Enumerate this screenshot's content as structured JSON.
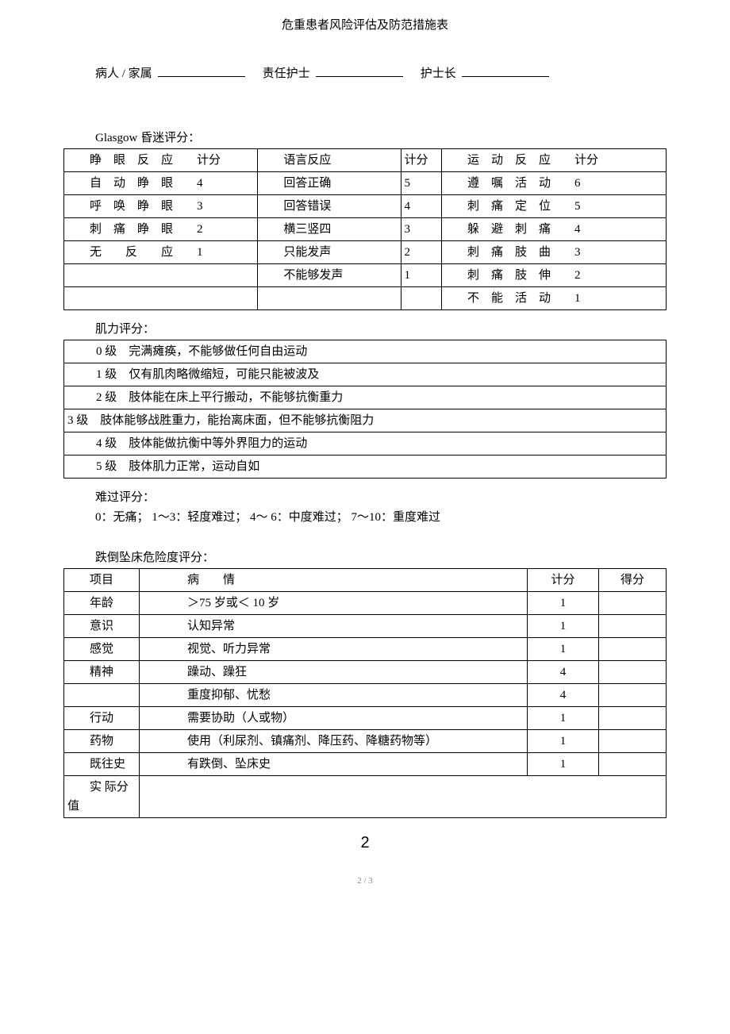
{
  "title": "危重患者风险评估及防范措施表",
  "signatures": {
    "patient_label": "病人 / 家属",
    "nurse_label": "责任护士",
    "headnurse_label": "护士长"
  },
  "glasgow": {
    "title": "Glasgow 昏迷评分：",
    "headers": {
      "eye": "睁　眼　反　应　　计分",
      "verbal": "语言反应",
      "vscore": "计分",
      "motor": "运　动　反　应　　计分"
    },
    "rows": [
      {
        "eye": "自　动　睁　眼　　4",
        "verbal": "回答正确",
        "vscore": "5",
        "motor": "遵　嘱　活　动　　6"
      },
      {
        "eye": "呼　唤　睁　眼　　3",
        "verbal": "回答错误",
        "vscore": "4",
        "motor": "刺　痛　定　位　　5"
      },
      {
        "eye": "刺　痛　睁　眼　　2",
        "verbal": "横三竖四",
        "vscore": "3",
        "motor": "躲　避　刺　痛　　4"
      },
      {
        "eye": "无　　反　　应　　1",
        "verbal": "只能发声",
        "vscore": "2",
        "motor": "刺　痛　肢　曲　　3"
      },
      {
        "eye": "",
        "verbal": "不能够发声",
        "vscore": "1",
        "motor": "刺　痛　肢　伸　　2"
      },
      {
        "eye": "",
        "verbal": "",
        "vscore": "",
        "motor": "不　能　活　动　　1"
      }
    ]
  },
  "muscle": {
    "title": "肌力评分：",
    "rows": [
      "0 级　完满瘫痪，不能够做任何自由运动",
      "1 级　仅有肌肉略微缩短，可能只能被波及",
      "2 级　肢体能在床上平行搬动，不能够抗衡重力",
      "3 级　肢体能够战胜重力，能抬离床面，但不能够抗衡阻力",
      "4 级　肢体能做抗衡中等外界阻力的运动",
      "5 级　肢体肌力正常，运动自如"
    ]
  },
  "pain": {
    "title": "难过评分：",
    "scale": "0：无痛； 1～3：轻度难过； 4～ 6：中度难过； 7～10：重度难过"
  },
  "fall": {
    "title": "跌倒坠床危险度评分：",
    "headers": {
      "item": "项目",
      "cond": "病　　情",
      "score": "计分",
      "got": "得分"
    },
    "rows": [
      {
        "item": "年龄",
        "cond": "＞75 岁或＜ 10 岁",
        "score": "1"
      },
      {
        "item": "意识",
        "cond": "认知异常",
        "score": "1"
      },
      {
        "item": "感觉",
        "cond": "视觉、听力异常",
        "score": "1"
      },
      {
        "item": "精神",
        "cond": "躁动、躁狂",
        "score": "4"
      },
      {
        "item": "",
        "cond": "重度抑郁、忧愁",
        "score": "4"
      },
      {
        "item": "行动",
        "cond": "需要协助（人或物）",
        "score": "1"
      },
      {
        "item": "药物",
        "cond": "使用（利尿剂、镇痛剂、降压药、降糖药物等）",
        "score": "1"
      },
      {
        "item": "既往史",
        "cond": "有跌倒、坠床史",
        "score": "1"
      }
    ],
    "total_label": "实 际分值"
  },
  "page_number_big": "2",
  "footer": "2 / 3"
}
